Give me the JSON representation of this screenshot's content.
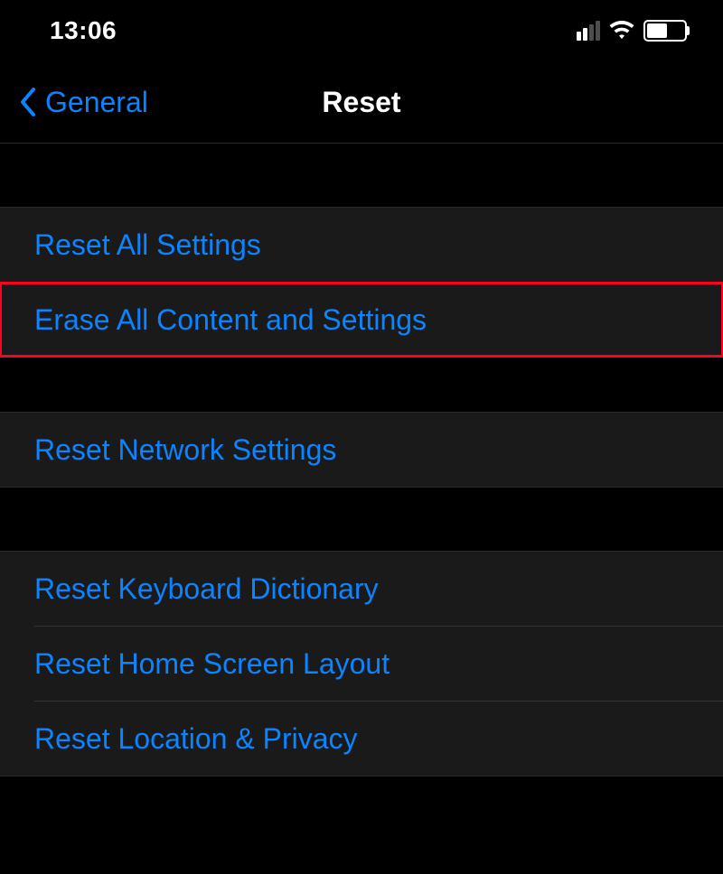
{
  "status_bar": {
    "time": "13:06"
  },
  "nav": {
    "back_label": "General",
    "title": "Reset"
  },
  "sections": {
    "group1": {
      "item1": "Reset All Settings",
      "item2": "Erase All Content and Settings"
    },
    "group2": {
      "item1": "Reset Network Settings"
    },
    "group3": {
      "item1": "Reset Keyboard Dictionary",
      "item2": "Reset Home Screen Layout",
      "item3": "Reset Location & Privacy"
    }
  }
}
